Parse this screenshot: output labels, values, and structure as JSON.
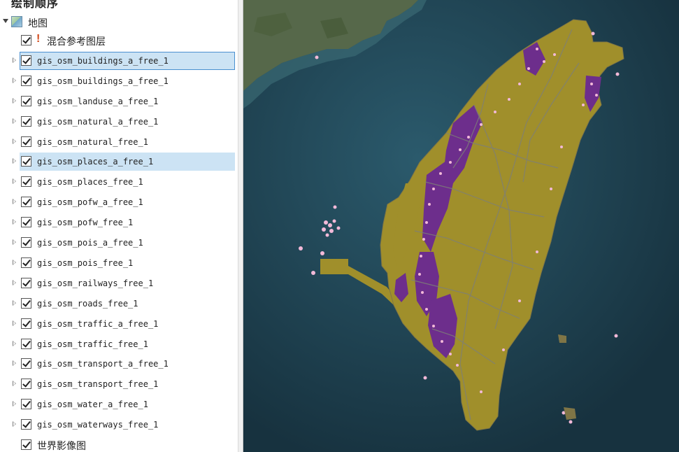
{
  "toc": {
    "title": "绘制顺序",
    "map_node": {
      "label": "地图",
      "icon": "map-icon"
    },
    "reference_layer": {
      "label": "混合参考图层",
      "icon": "warning-icon",
      "checked": true
    },
    "layers": [
      {
        "name": "gis_osm_buildings_a_free_1",
        "checked": true,
        "selected": true,
        "focused": true
      },
      {
        "name": "gis_osm_buildings_a_free_1",
        "checked": true
      },
      {
        "name": "gis_osm_landuse_a_free_1",
        "checked": true
      },
      {
        "name": "gis_osm_natural_a_free_1",
        "checked": true
      },
      {
        "name": "gis_osm_natural_free_1",
        "checked": true
      },
      {
        "name": "gis_osm_places_a_free_1",
        "checked": true,
        "selected": true
      },
      {
        "name": "gis_osm_places_free_1",
        "checked": true
      },
      {
        "name": "gis_osm_pofw_a_free_1",
        "checked": true
      },
      {
        "name": "gis_osm_pofw_free_1",
        "checked": true
      },
      {
        "name": "gis_osm_pois_a_free_1",
        "checked": true
      },
      {
        "name": "gis_osm_pois_free_1",
        "checked": true
      },
      {
        "name": "gis_osm_railways_free_1",
        "checked": true
      },
      {
        "name": "gis_osm_roads_free_1",
        "checked": true
      },
      {
        "name": "gis_osm_traffic_a_free_1",
        "checked": true
      },
      {
        "name": "gis_osm_traffic_free_1",
        "checked": true
      },
      {
        "name": "gis_osm_transport_a_free_1",
        "checked": true
      },
      {
        "name": "gis_osm_transport_free_1",
        "checked": true
      },
      {
        "name": "gis_osm_water_a_free_1",
        "checked": true
      },
      {
        "name": "gis_osm_waterways_free_1",
        "checked": true
      }
    ],
    "basemap_layer": {
      "label": "世界影像图",
      "checked": true
    }
  },
  "map_view": {
    "colors": {
      "ocean": "#1e3f53",
      "shallow": "#3a6a74",
      "land_mainland": "#5c6d4a",
      "landuse_fill": "#a08f2b",
      "landuse_outline": "#7f7546",
      "buildings_fill": "#6d2e8c",
      "points": "#f2b9d8",
      "roads": "#7e7f77"
    }
  }
}
